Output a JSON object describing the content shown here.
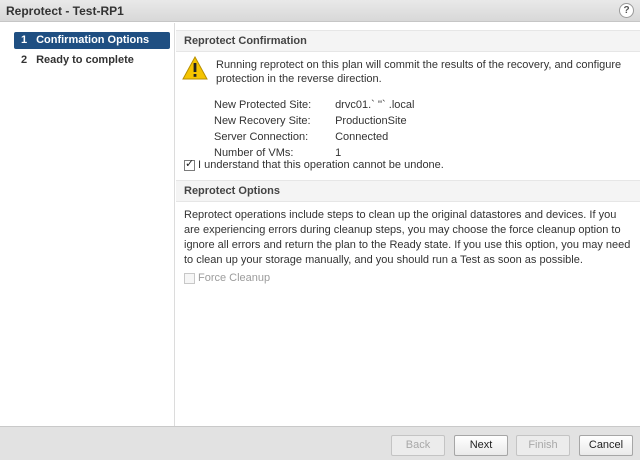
{
  "window": {
    "title": "Reprotect - Test-RP1",
    "help_label": "?"
  },
  "steps": [
    {
      "num": "1",
      "label": "Confirmation Options",
      "active": true
    },
    {
      "num": "2",
      "label": "Ready to complete",
      "active": false
    }
  ],
  "confirmation": {
    "header": "Reprotect Confirmation",
    "warning": "Running reprotect on this plan will commit the results of the recovery, and configure protection in the reverse direction.",
    "details": [
      {
        "label": "New Protected Site:",
        "value": "drvc01.`  ''`  .local"
      },
      {
        "label": "New Recovery Site:",
        "value": "ProductionSite"
      },
      {
        "label": "Server Connection:",
        "value": "Connected"
      },
      {
        "label": "Number of VMs:",
        "value": "1"
      }
    ],
    "acknowledge_label": "I understand that this operation cannot be undone.",
    "acknowledge_checked": true
  },
  "options": {
    "header": "Reprotect Options",
    "description": "Reprotect operations include steps to clean up the original datastores and devices. If you are experiencing errors during cleanup steps, you may choose the force cleanup option to ignore all errors and return the plan to the Ready state. If you use this option, you may need to clean up your storage manually, and you should run a Test as soon as possible.",
    "force_cleanup_label": "Force Cleanup",
    "force_cleanup_enabled": false
  },
  "footer": {
    "back_label": "Back",
    "next_label": "Next",
    "finish_label": "Finish",
    "cancel_label": "Cancel"
  },
  "colors": {
    "active_step": "#1f4f82",
    "warning": "#f5c400"
  },
  "icons": {
    "help": "help-icon",
    "warning": "warning-icon",
    "checkbox": "checkbox-icon"
  }
}
